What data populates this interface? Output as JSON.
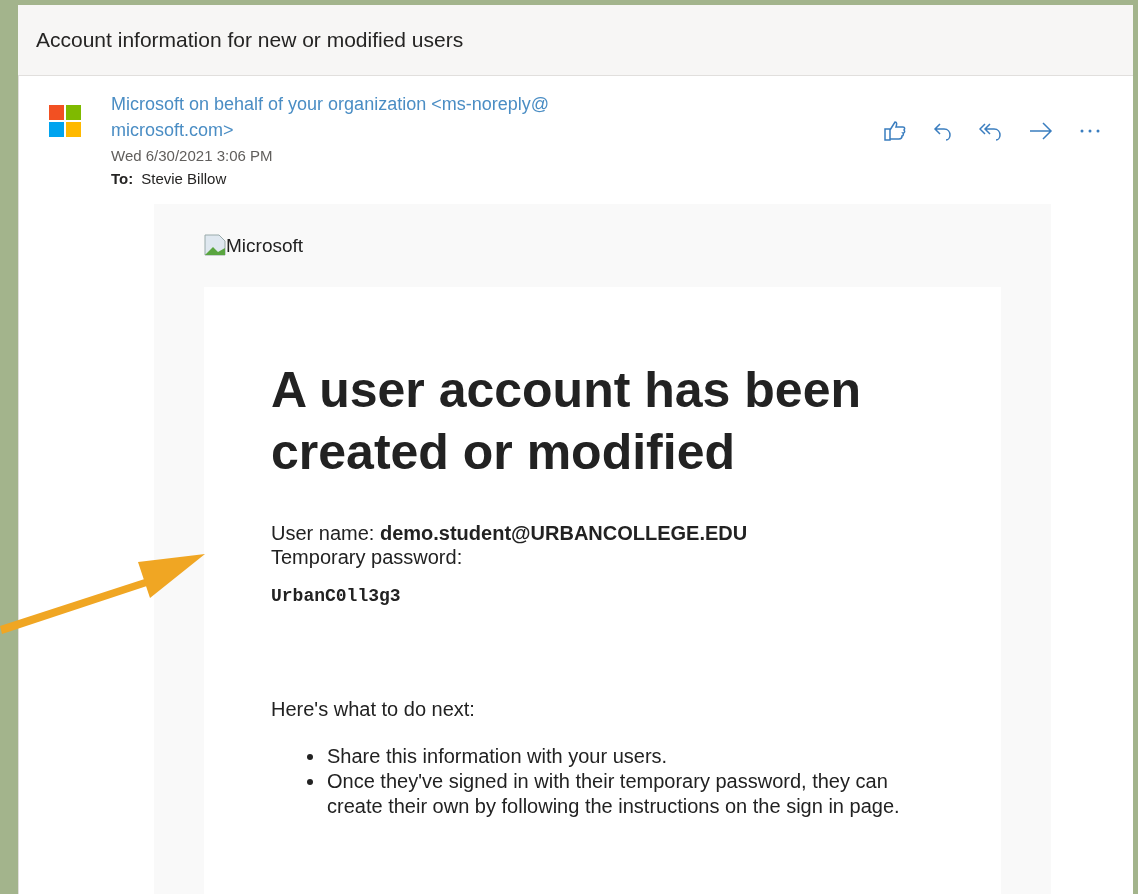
{
  "subject": "Account information for new or modified users",
  "sender": {
    "name": "Microsoft on behalf of your organization <ms-noreply@ microsoft.com>",
    "date": "Wed 6/30/2021 3:06 PM",
    "to_label": "To:",
    "to": "Stevie Billow"
  },
  "body": {
    "logo_alt": "Microsoft",
    "heading": "A user account has been created or modified",
    "username_line": "User name: **demo.student@URBANCOLLEGE.EDU**",
    "password_label": "Temporary password:",
    "password": "UrbanC0ll3g3",
    "next_heading": "Here's what to do next:",
    "steps": [
      "Share this information with your users.",
      "Once they've signed in with their temporary password, they can create their own by following the instructions on the sign in page."
    ]
  }
}
